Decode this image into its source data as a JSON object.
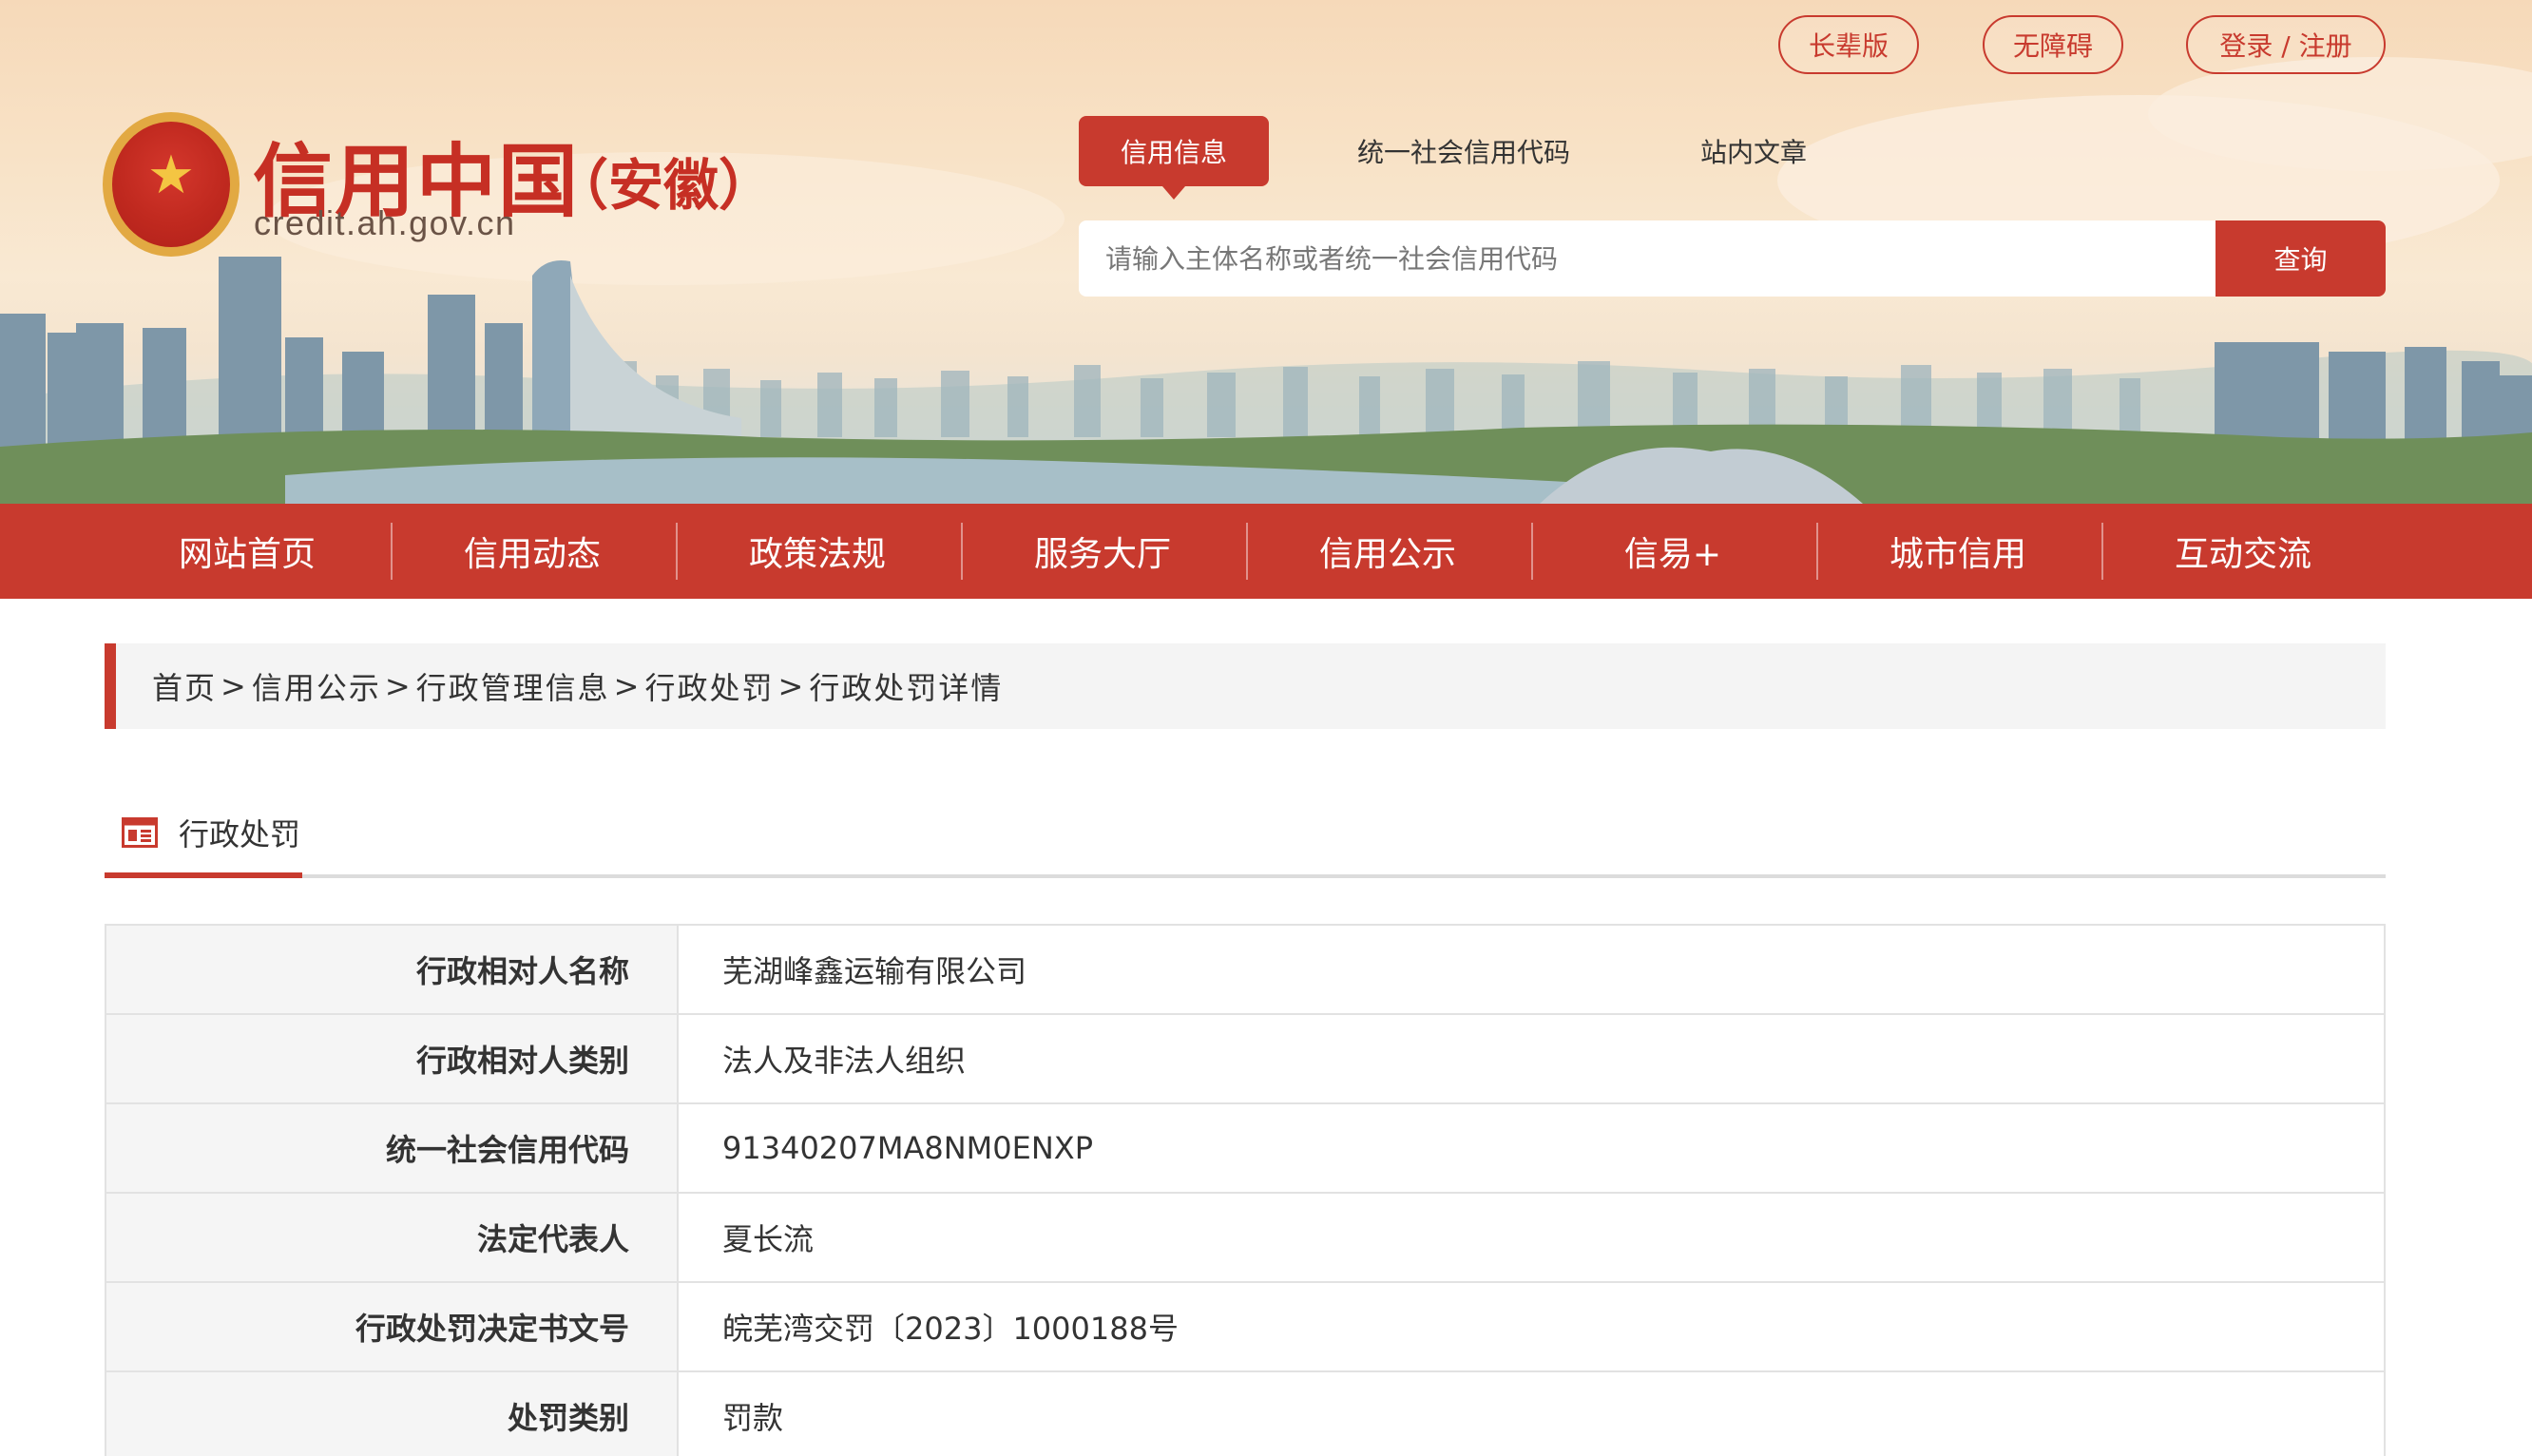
{
  "site": {
    "title": "信用中国",
    "subtitle": "（安徽）",
    "url": "credit.ah.gov.cn"
  },
  "topbar": {
    "elder_label": "长辈版",
    "accessibility_label": "无障碍",
    "login_label": "登录 / 注册"
  },
  "search": {
    "tabs": [
      {
        "label": "信用信息",
        "active": true
      },
      {
        "label": "统一社会信用代码",
        "active": false
      },
      {
        "label": "站内文章",
        "active": false
      }
    ],
    "placeholder": "请输入主体名称或者统一社会信用代码",
    "button_label": "查询"
  },
  "nav": {
    "items": [
      {
        "label": "网站首页"
      },
      {
        "label": "信用动态"
      },
      {
        "label": "政策法规"
      },
      {
        "label": "服务大厅"
      },
      {
        "label": "信用公示"
      },
      {
        "label": "信易+"
      },
      {
        "label": "城市信用"
      },
      {
        "label": "互动交流"
      }
    ]
  },
  "breadcrumb": {
    "items": [
      "首页",
      "信用公示",
      "行政管理信息",
      "行政处罚",
      "行政处罚详情"
    ],
    "separator": ">"
  },
  "section": {
    "title": "行政处罚",
    "icon": "document-list-icon"
  },
  "detail": {
    "rows": [
      {
        "label": "行政相对人名称",
        "value": "芜湖峰鑫运输有限公司"
      },
      {
        "label": "行政相对人类别",
        "value": "法人及非法人组织"
      },
      {
        "label": "统一社会信用代码",
        "value": "91340207MA8NM0ENXP"
      },
      {
        "label": "法定代表人",
        "value": "夏长流"
      },
      {
        "label": "行政处罚决定书文号",
        "value": "皖芜湾交罚〔2023〕1000188号"
      },
      {
        "label": "处罚类别",
        "value": "罚款"
      }
    ]
  },
  "colors": {
    "brand_red": "#c83a2e",
    "banner_sky": "#f6d9b9"
  }
}
